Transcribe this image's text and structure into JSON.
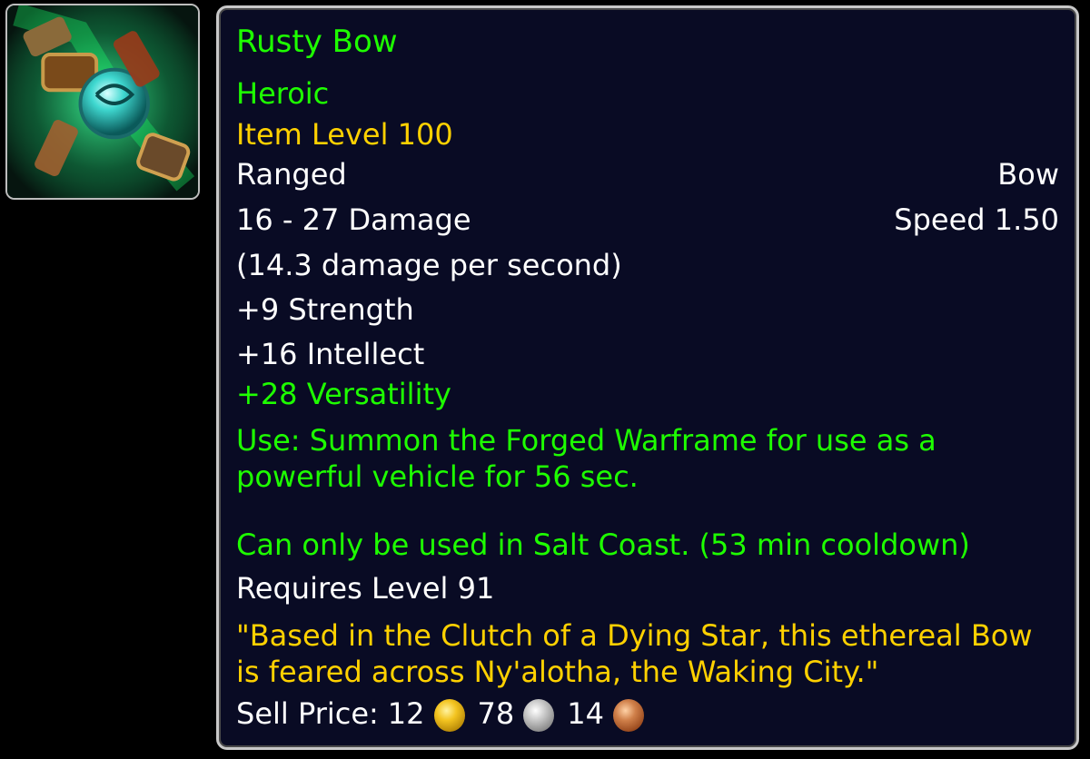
{
  "item": {
    "name": "Rusty Bow",
    "difficulty": "Heroic",
    "item_level": "Item Level 100",
    "slot": "Ranged",
    "type": "Bow",
    "damage": "16 - 27 Damage",
    "speed": "Speed 1.50",
    "dps": "(14.3 damage per second)",
    "stats": {
      "strength": "+9 Strength",
      "intellect": "+16 Intellect",
      "versatility": "+28 Versatility"
    },
    "use_text": "Use: Summon the Forged Warframe for use as a powerful vehicle for 56 sec.",
    "restriction_text": "Can only be used in Salt Coast. (53 min cooldown)",
    "requires": "Requires Level 91",
    "flavor": "\"Based in the Clutch of a Dying Star, this ethereal Bow is feared across Ny'alotha, the Waking City.\"",
    "sell_price": {
      "label": "Sell Price:",
      "gold": "12",
      "silver": "78",
      "copper": "14"
    },
    "icon": "bow-item-icon"
  },
  "colors": {
    "uncommon_green": "#1eff00",
    "gold_text": "#ffd100",
    "white_text": "#ffffff",
    "tooltip_bg": "#090b24",
    "border": "#c8c8c8"
  }
}
